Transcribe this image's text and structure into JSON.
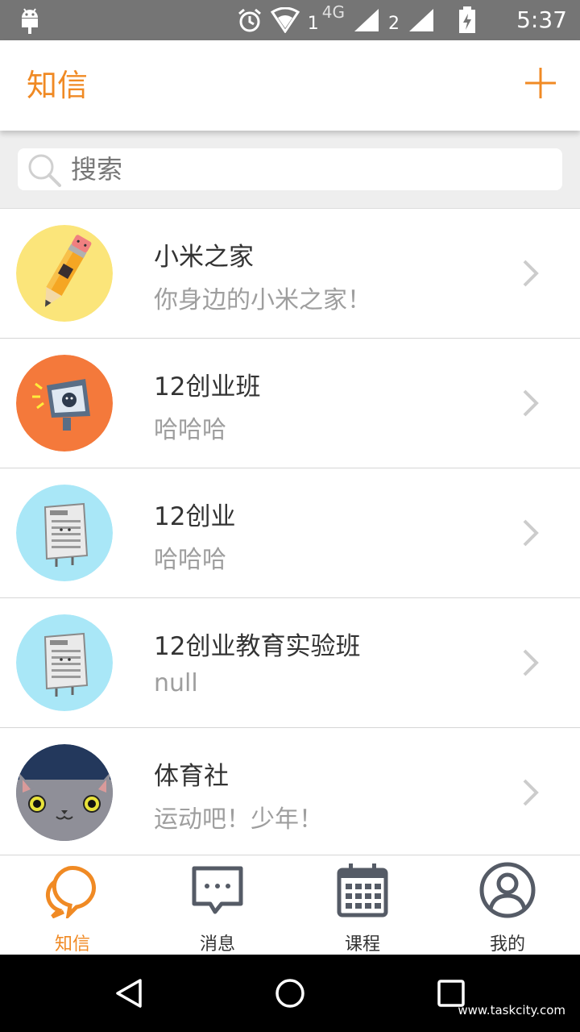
{
  "status_bar": {
    "time": "5:37",
    "sim1_label": "1",
    "network_label": "4G",
    "sim2_label": "2"
  },
  "app_bar": {
    "title": "知信",
    "add_icon": "plus-icon",
    "accent_color": "#f08a24"
  },
  "search": {
    "placeholder": "搜索",
    "value": ""
  },
  "conversations": [
    {
      "name": "小米之家",
      "desc": "你身边的小米之家！",
      "avatar": "pencil-avatar"
    },
    {
      "name": "12创业班",
      "desc": "哈哈哈",
      "avatar": "megaphone-avatar"
    },
    {
      "name": "12创业",
      "desc": "哈哈哈",
      "avatar": "newspaper-avatar"
    },
    {
      "name": "12创业教育实验班",
      "desc": "null",
      "avatar": "newspaper-avatar"
    },
    {
      "name": "体育社",
      "desc": "运动吧！少年！",
      "avatar": "cat-avatar"
    }
  ],
  "tabs": [
    {
      "label": "知信",
      "icon": "chat-bubble-icon",
      "active": true
    },
    {
      "label": "消息",
      "icon": "message-icon",
      "active": false
    },
    {
      "label": "课程",
      "icon": "calendar-icon",
      "active": false
    },
    {
      "label": "我的",
      "icon": "profile-icon",
      "active": false
    }
  ],
  "watermark": "www.taskcity.com"
}
